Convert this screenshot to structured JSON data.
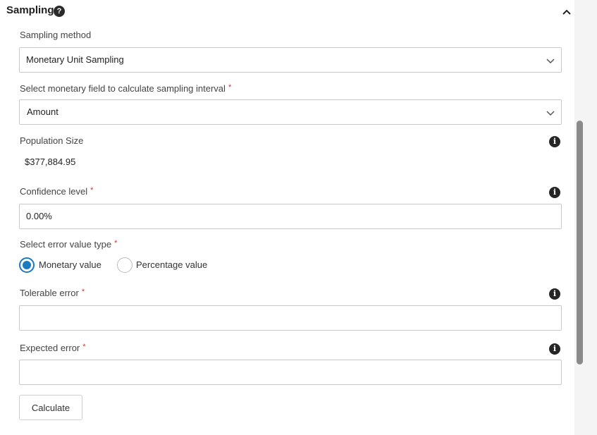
{
  "section": {
    "title": "Sampling",
    "help_icon": "?"
  },
  "sampling_method": {
    "label": "Sampling method",
    "value": "Monetary Unit Sampling"
  },
  "monetary_field": {
    "label": "Select monetary field to calculate sampling interval",
    "required_mark": "*",
    "value": "Amount"
  },
  "population_size": {
    "label": "Population Size",
    "value": "$377,884.95"
  },
  "confidence_level": {
    "label": "Confidence level",
    "required_mark": "*",
    "value": "0.00%"
  },
  "error_value_type": {
    "label": "Select error value type",
    "required_mark": "*",
    "options": [
      {
        "label": "Monetary value",
        "checked": true
      },
      {
        "label": "Percentage value",
        "checked": false
      }
    ]
  },
  "tolerable_error": {
    "label": "Tolerable error",
    "required_mark": "*",
    "value": ""
  },
  "expected_error": {
    "label": "Expected error",
    "required_mark": "*",
    "value": ""
  },
  "info_icon_glyph": "i",
  "calculate_button": {
    "label": "Calculate"
  },
  "colors": {
    "accent": "#1c7bbf",
    "required": "#d0342c",
    "border": "#c9c9c9"
  }
}
